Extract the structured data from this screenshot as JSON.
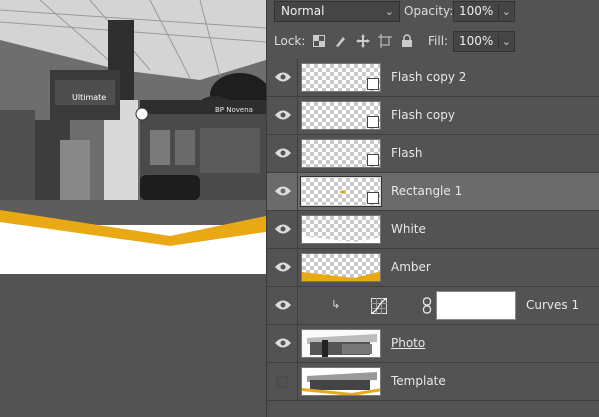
{
  "blend_mode": {
    "value": "Normal"
  },
  "opacity": {
    "label": "Opacity:",
    "value": "100%"
  },
  "lock": {
    "label": "Lock:"
  },
  "fill": {
    "label": "Fill:",
    "value": "100%"
  },
  "canvas_photo_signs": {
    "sign1": "Ultimate",
    "sign2": "BP Novena"
  },
  "layers": [
    {
      "name": "Flash copy 2",
      "visible": true,
      "kind": "smart"
    },
    {
      "name": "Flash copy",
      "visible": true,
      "kind": "smart"
    },
    {
      "name": "Flash",
      "visible": true,
      "kind": "smart"
    },
    {
      "name": "Rectangle 1",
      "visible": true,
      "kind": "smart",
      "selected": true
    },
    {
      "name": "White",
      "visible": true,
      "kind": "shape"
    },
    {
      "name": "Amber",
      "visible": true,
      "kind": "shape"
    },
    {
      "name": "Curves 1",
      "visible": true,
      "kind": "adjustment"
    },
    {
      "name": "Photo",
      "visible": true,
      "kind": "pixel"
    },
    {
      "name": "Template",
      "visible": false,
      "kind": "pixel"
    }
  ],
  "colors": {
    "amber": "#e8a915",
    "panel": "#535353",
    "selected": "#6b6b6b"
  }
}
